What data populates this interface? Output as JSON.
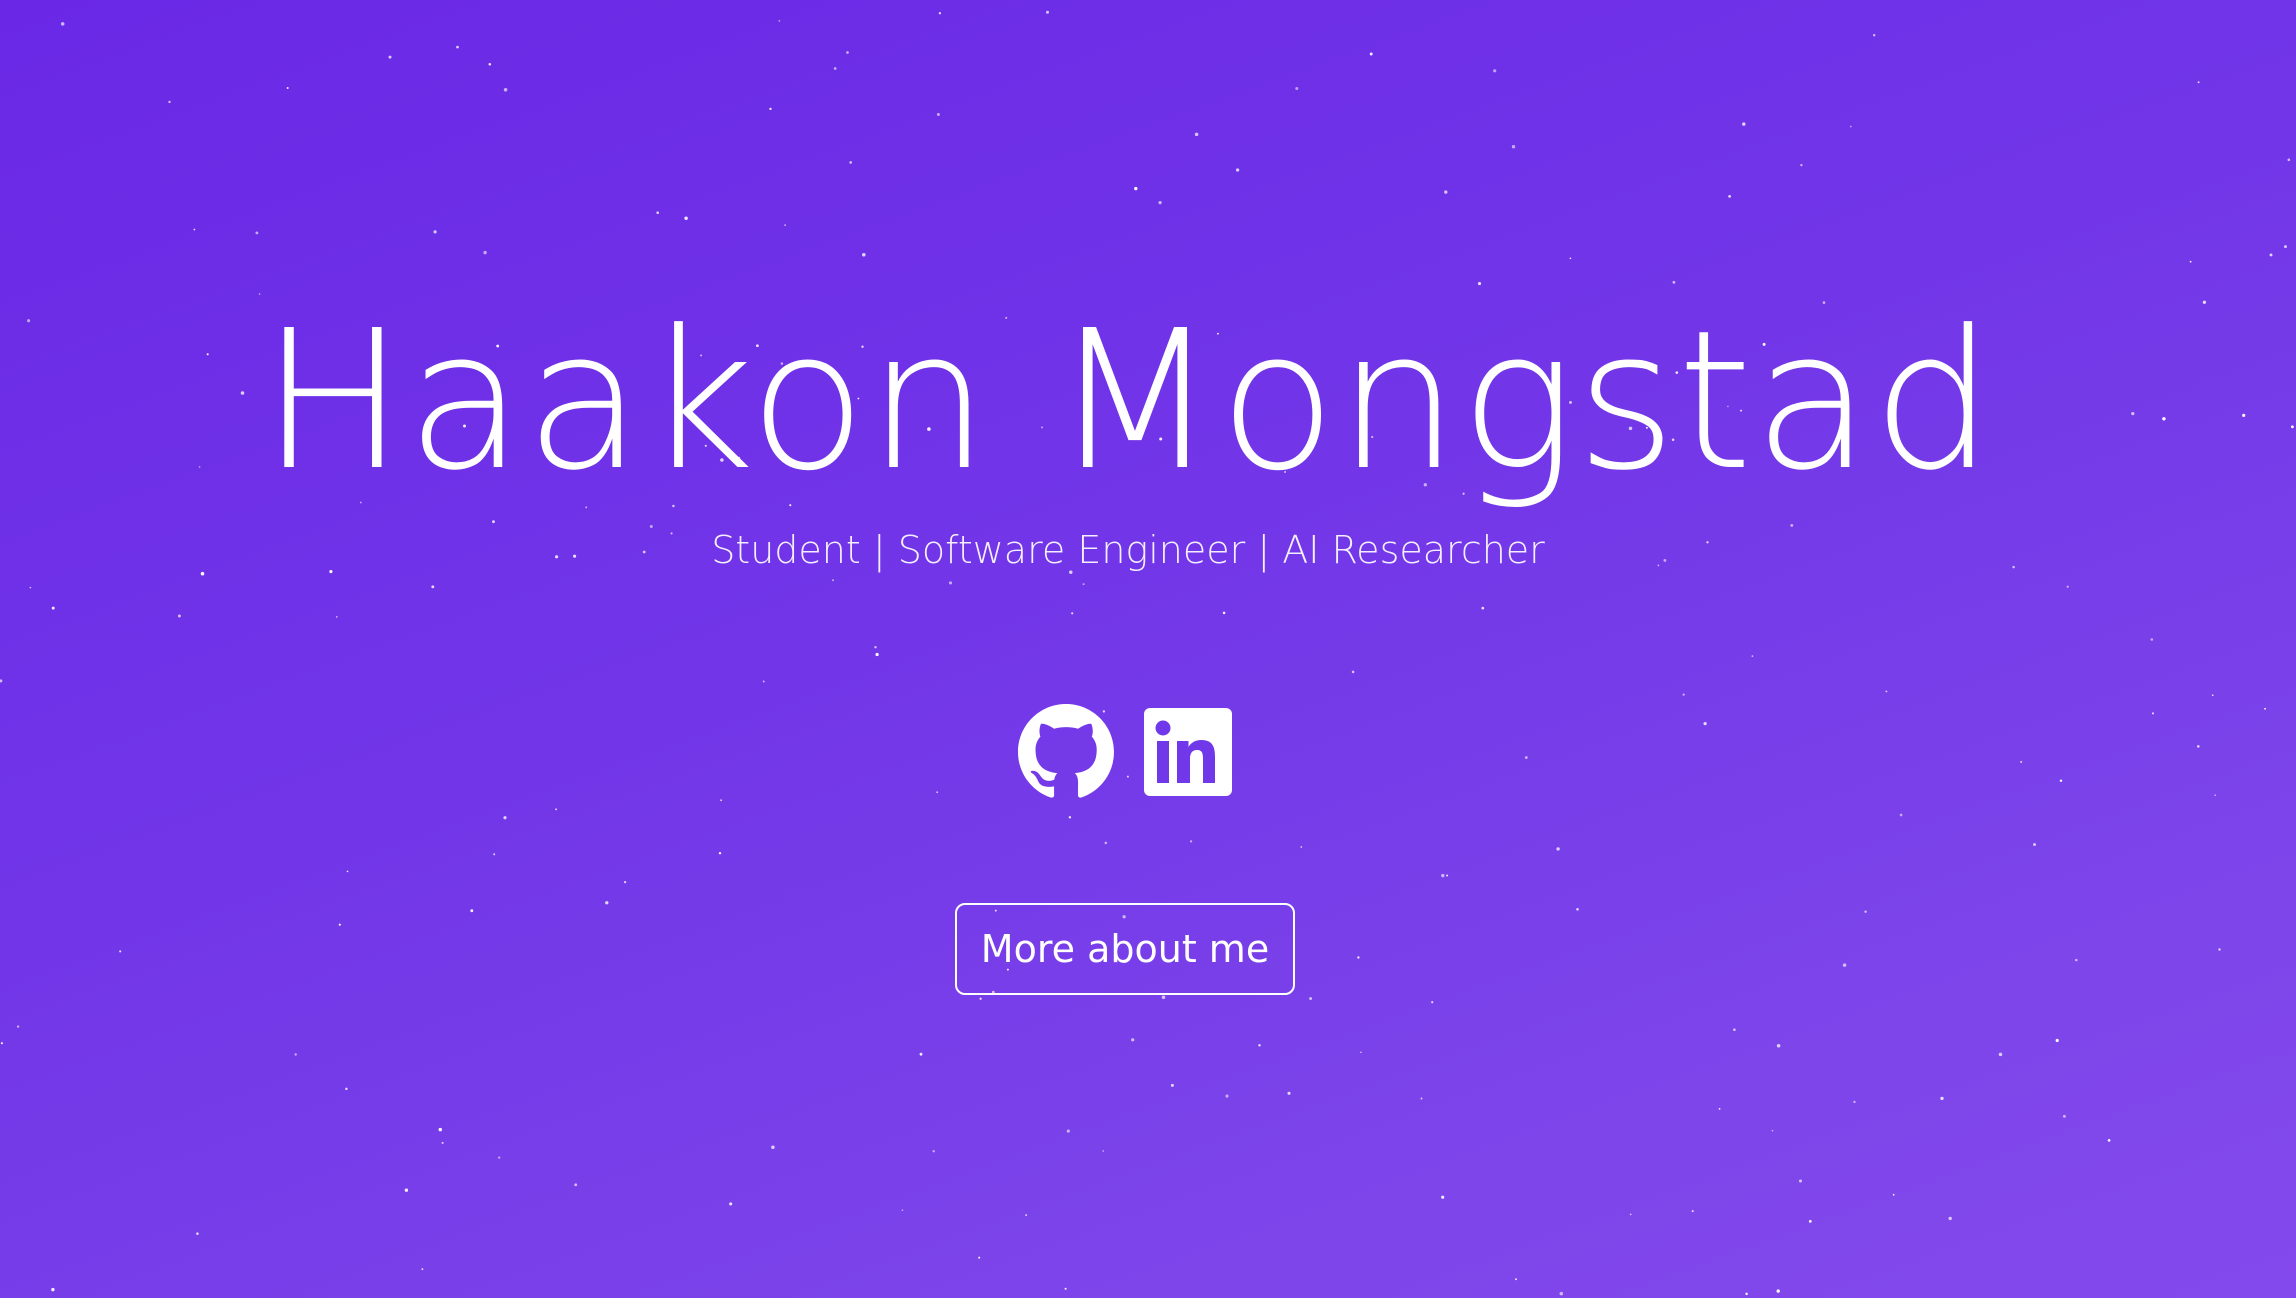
{
  "hero": {
    "name": "Haakon Mongstad",
    "tagline": "Student | Software Engineer | AI Researcher",
    "background_colors": [
      "#6a28e6",
      "#8449ec"
    ]
  },
  "social": [
    {
      "icon": "github-icon",
      "label": "GitHub"
    },
    {
      "icon": "linkedin-icon",
      "label": "LinkedIn"
    }
  ],
  "cta": {
    "label": "More about me"
  }
}
